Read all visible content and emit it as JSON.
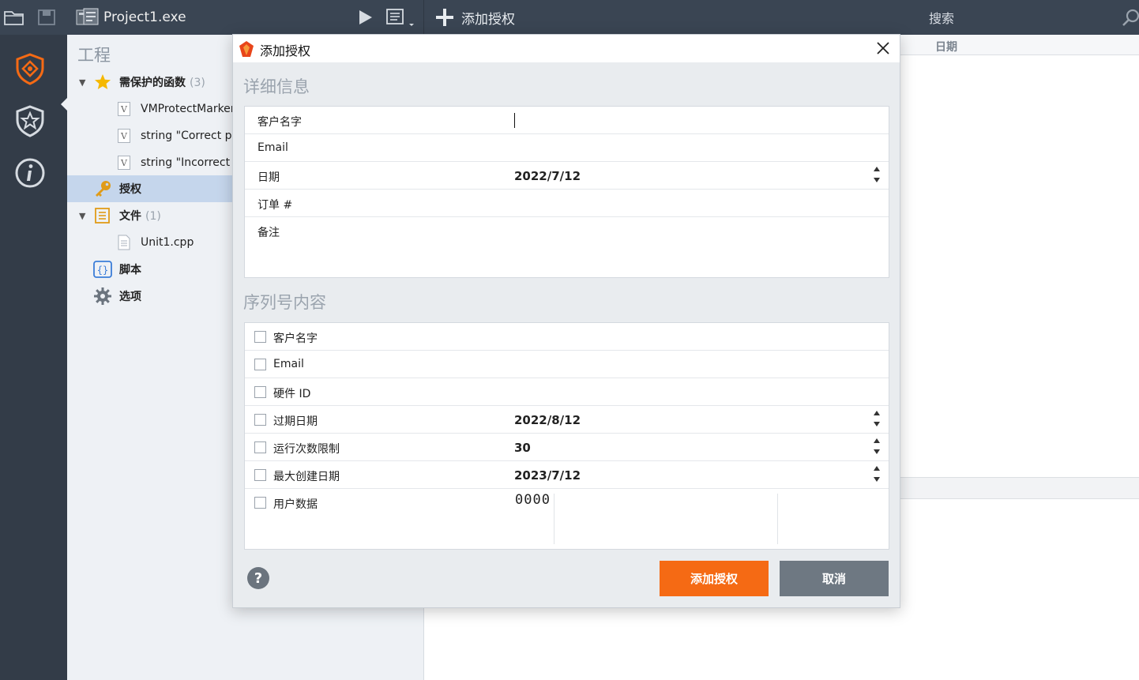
{
  "toolbar": {
    "project_title": "Project1.exe",
    "add_license_label": "添加授权",
    "search_label": "搜索"
  },
  "tree": {
    "title": "工程",
    "protected_functions": {
      "label": "需保护的函数",
      "count": "(3)"
    },
    "functions": [
      {
        "label": "VMProtectMarker"
      },
      {
        "label": "string \"Correct pa"
      },
      {
        "label": "string \"Incorrect p"
      }
    ],
    "licenses": {
      "label": "授权"
    },
    "files": {
      "label": "文件",
      "count": "(1)"
    },
    "file_items": [
      {
        "label": "Unit1.cpp"
      }
    ],
    "scripts": {
      "label": "脚本"
    },
    "options": {
      "label": "选项"
    }
  },
  "right_panel": {
    "date_header": "日期"
  },
  "dialog": {
    "title": "添加授权",
    "details_section": "详细信息",
    "details": {
      "customer_name_label": "客户名字",
      "customer_name_value": "",
      "email_label": "Email",
      "date_label": "日期",
      "date_value": "2022/7/12",
      "order_label": "订单 #",
      "notes_label": "备注"
    },
    "serial_section": "序列号内容",
    "serial": {
      "customer_name_label": "客户名字",
      "email_label": "Email",
      "hwid_label": "硬件 ID",
      "expiry_label": "过期日期",
      "expiry_value": "2022/8/12",
      "run_limit_label": "运行次数限制",
      "run_limit_value": "30",
      "max_build_label": "最大创建日期",
      "max_build_value": "2023/7/12",
      "user_data_label": "用户数据",
      "user_data_value": "0000"
    },
    "help_label": "?",
    "add_button": "添加授权",
    "cancel_button": "取消"
  },
  "colors": {
    "accent_orange": "#f56a14",
    "toolbar_bg": "#3a4553",
    "rail_bg": "#333c48",
    "cancel_bg": "#6e7882"
  }
}
